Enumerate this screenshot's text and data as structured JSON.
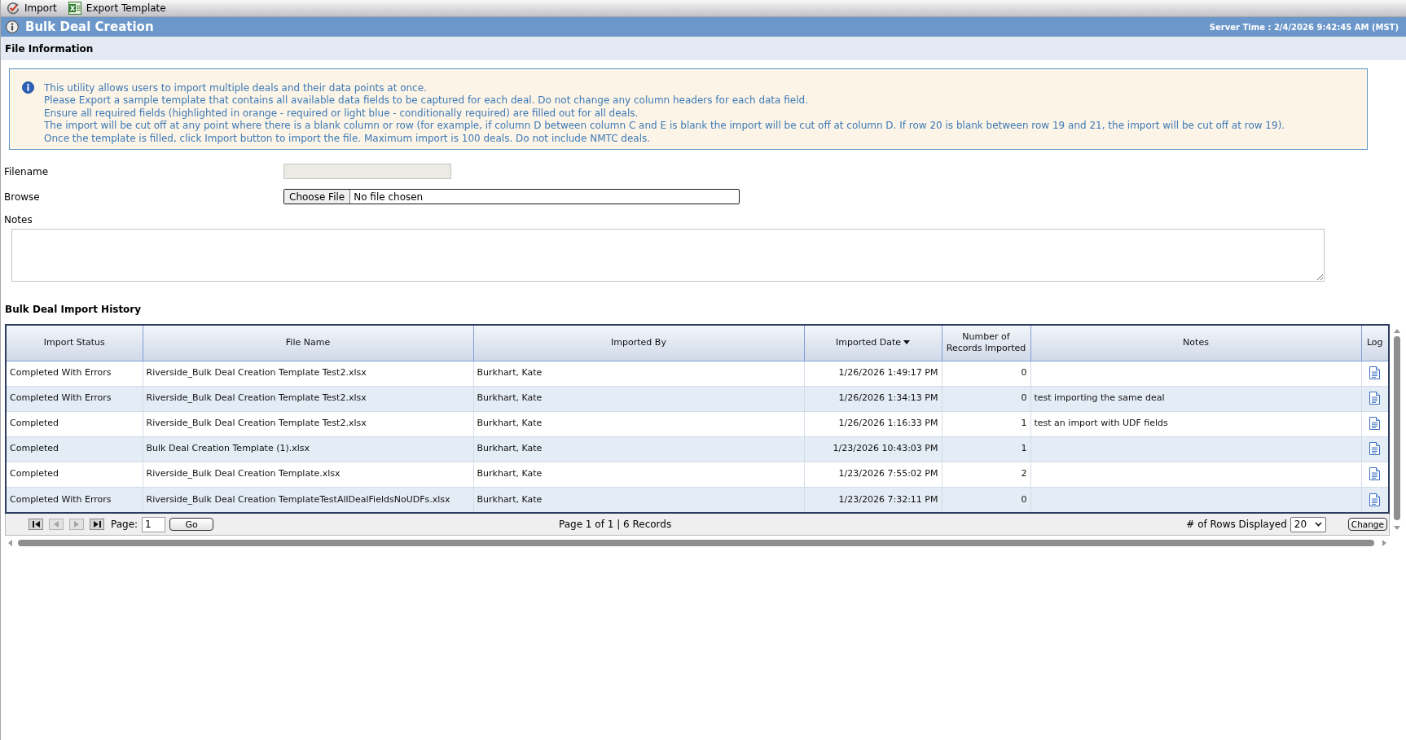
{
  "toolbar": [
    {
      "kind": "import",
      "label": "Import"
    },
    {
      "kind": "export",
      "label": "Export Template"
    }
  ],
  "title_bar": {
    "title": "Bulk Deal Creation",
    "server_time": "Server Time : 2/4/2026 9:42:45 AM (MST)"
  },
  "file_information": {
    "heading": "File Information",
    "info_lines": [
      "This utility allows users to import multiple deals and their data points at once.",
      "Please Export a sample template that contains all available data fields to be captured for each deal. Do not change any column headers for each data field.",
      "Ensure all required fields (highlighted in orange - required or light blue - conditionally required) are filled out for all deals.",
      "The import will be cut off at any point where there is a blank column or row (for example, if column D between column C and E is blank the import will be cut off at column D. If row 20 is blank between row 19 and 21, the import will be cut off at row 19).",
      "Once the template is filled, click Import button to import the file. Maximum import is 100 deals. Do not include NMTC deals."
    ],
    "filename": {
      "label": "Filename",
      "disabled": true
    },
    "browse": {
      "label": "Browse",
      "button": "Choose File",
      "status": "No file chosen"
    },
    "notes": {
      "label": "Notes"
    }
  },
  "import_history": {
    "heading": "Bulk Deal Import History",
    "table": {
      "columns": [
        {
          "label": "Import Status",
          "sorted": false
        },
        {
          "label": "File Name",
          "sorted": false
        },
        {
          "label": "Imported By",
          "sorted": false
        },
        {
          "label": "Imported Date",
          "sorted": true
        },
        {
          "label": "Number of Records Imported",
          "sorted": false
        },
        {
          "label": "Notes",
          "sorted": false
        },
        {
          "label": "Log",
          "sorted": false
        }
      ],
      "rows": [
        {
          "import_status": "Completed With Errors",
          "file_name": "Riverside_Bulk Deal Creation Template Test2.xlsx",
          "imported_by": "Burkhart, Kate",
          "imported_date": "1/26/2026 1:49:17 PM",
          "records_imported": "0"
        },
        {
          "import_status": "Completed With Errors",
          "file_name": "Riverside_Bulk Deal Creation Template Test2.xlsx",
          "imported_by": "Burkhart, Kate",
          "imported_date": "1/26/2026 1:34:13 PM",
          "records_imported": "0",
          "notes": "test importing the same deal"
        },
        {
          "import_status": "Completed",
          "file_name": "Riverside_Bulk Deal Creation Template Test2.xlsx",
          "imported_by": "Burkhart, Kate",
          "imported_date": "1/26/2026 1:16:33 PM",
          "records_imported": "1",
          "notes": "test an import with UDF fields"
        },
        {
          "import_status": "Completed",
          "file_name": "Bulk Deal Creation Template (1).xlsx",
          "imported_by": "Burkhart, Kate",
          "imported_date": "1/23/2026 10:43:03 PM",
          "records_imported": "1"
        },
        {
          "import_status": "Completed",
          "file_name": "Riverside_Bulk Deal Creation Template.xlsx",
          "imported_by": "Burkhart, Kate",
          "imported_date": "1/23/2026 7:55:02 PM",
          "records_imported": "2"
        },
        {
          "import_status": "Completed With Errors",
          "file_name": "Riverside_Bulk Deal Creation TemplateTestAllDealFieldsNoUDFs.xlsx",
          "imported_by": "Burkhart, Kate",
          "imported_date": "1/23/2026 7:32:11 PM",
          "records_imported": "0"
        }
      ]
    },
    "pager": {
      "nav_buttons": [
        {
          "kind": "first",
          "disabled": false
        },
        {
          "kind": "previous",
          "disabled": true
        },
        {
          "kind": "next",
          "disabled": true
        },
        {
          "kind": "last",
          "disabled": false
        }
      ],
      "page_label": "Page:",
      "page_value": "1",
      "go_button": "Go",
      "summary": "Page 1 of 1 | 6 Records",
      "rows_label": "# of Rows Displayed",
      "rows_value": "20",
      "change_button": "Change"
    }
  }
}
